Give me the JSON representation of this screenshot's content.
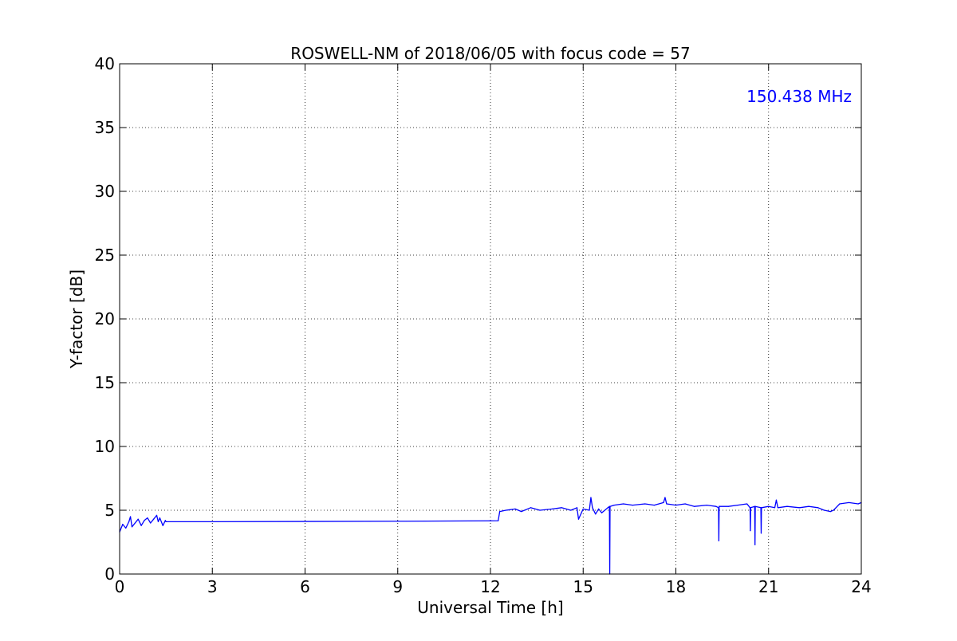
{
  "chart_data": {
    "type": "line",
    "title": "ROSWELL-NM of 2018/06/05 with focus code = 57",
    "xlabel": "Universal Time [h]",
    "ylabel": "Y-factor [dB]",
    "xlim": [
      0,
      24
    ],
    "ylim": [
      0,
      40
    ],
    "xticks": [
      "0",
      "3",
      "6",
      "9",
      "12",
      "15",
      "18",
      "21",
      "24"
    ],
    "yticks": [
      "0",
      "5",
      "10",
      "15",
      "20",
      "25",
      "30",
      "35",
      "40"
    ],
    "grid": true,
    "annotation": "150.438 MHz",
    "annotation_position": "top-right",
    "series": [
      {
        "color": "#0000ff",
        "x": [
          0.0,
          0.1,
          0.2,
          0.3,
          0.35,
          0.4,
          0.5,
          0.6,
          0.7,
          0.8,
          0.9,
          1.0,
          1.1,
          1.2,
          1.25,
          1.3,
          1.4,
          1.48,
          1.5,
          3.0,
          6.0,
          9.0,
          12.0,
          12.25,
          12.3,
          12.5,
          12.8,
          13.0,
          13.3,
          13.6,
          14.0,
          14.3,
          14.6,
          14.8,
          14.85,
          15.0,
          15.2,
          15.25,
          15.3,
          15.4,
          15.5,
          15.6,
          15.8,
          15.85,
          15.86,
          15.87,
          16.0,
          16.3,
          16.6,
          17.0,
          17.3,
          17.6,
          17.65,
          17.7,
          18.0,
          18.3,
          18.6,
          19.0,
          19.3,
          19.38,
          19.39,
          19.4,
          19.7,
          20.0,
          20.3,
          20.4,
          20.41,
          20.42,
          20.55,
          20.56,
          20.57,
          20.75,
          20.76,
          20.77,
          21.0,
          21.2,
          21.25,
          21.3,
          21.6,
          22.0,
          22.3,
          22.6,
          22.8,
          23.0,
          23.1,
          23.3,
          23.6,
          23.9,
          24.0
        ],
        "y": [
          3.3,
          3.9,
          3.6,
          4.1,
          4.5,
          3.7,
          4.0,
          4.3,
          3.8,
          4.2,
          4.4,
          4.0,
          4.3,
          4.6,
          4.1,
          4.4,
          3.8,
          4.2,
          4.1,
          4.1,
          4.12,
          4.14,
          4.17,
          4.18,
          4.9,
          5.0,
          5.1,
          4.9,
          5.2,
          5.0,
          5.1,
          5.2,
          5.0,
          5.2,
          4.3,
          5.1,
          5.0,
          6.0,
          5.2,
          4.7,
          5.1,
          4.8,
          5.2,
          5.3,
          0.0,
          5.3,
          5.4,
          5.5,
          5.4,
          5.5,
          5.4,
          5.6,
          6.0,
          5.5,
          5.4,
          5.5,
          5.3,
          5.4,
          5.3,
          5.2,
          2.6,
          5.3,
          5.3,
          5.4,
          5.5,
          5.2,
          3.4,
          5.2,
          5.3,
          2.3,
          5.3,
          5.2,
          3.2,
          5.2,
          5.3,
          5.2,
          5.8,
          5.2,
          5.3,
          5.2,
          5.3,
          5.2,
          5.0,
          4.9,
          5.0,
          5.5,
          5.6,
          5.5,
          5.6
        ]
      }
    ]
  }
}
